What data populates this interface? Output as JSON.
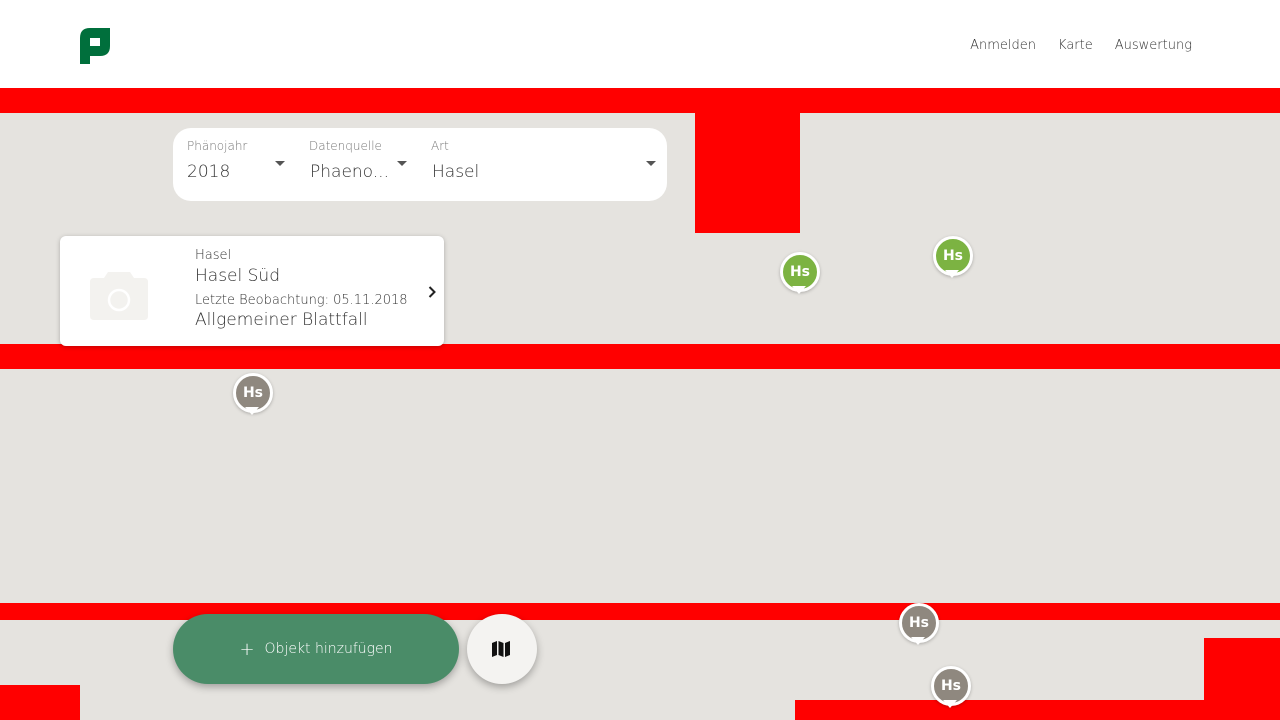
{
  "header": {
    "nav": [
      "Anmelden",
      "Karte",
      "Auswertung"
    ]
  },
  "filters": {
    "year": {
      "label": "Phänojahr",
      "value": "2018"
    },
    "source": {
      "label": "Datenquelle",
      "value": "Phaeno..."
    },
    "species": {
      "label": "Art",
      "value": "Hasel"
    }
  },
  "card": {
    "species": "Hasel",
    "name": "Hasel Süd",
    "last_observation": "Letzte Beobachtung: 05.11.2018",
    "phase": "Allgemeiner Blattfall",
    "photo_icon": "camera-icon"
  },
  "markers": [
    {
      "label": "Hs",
      "color": "#7cb342"
    },
    {
      "label": "Hs",
      "color": "#7cb342"
    },
    {
      "label": "Hs",
      "color": "#8f887f"
    },
    {
      "label": "Hs",
      "color": "#8f887f"
    },
    {
      "label": "Hs",
      "color": "#8f887f"
    }
  ],
  "actions": {
    "add_label": "Objekt hinzufügen",
    "map_icon": "map-icon"
  },
  "colors": {
    "brand": "#006f3c",
    "add_button": "#4a8c68",
    "marker_green": "#7cb342",
    "marker_grey": "#8f887f",
    "map_bg": "#e5e3df"
  }
}
